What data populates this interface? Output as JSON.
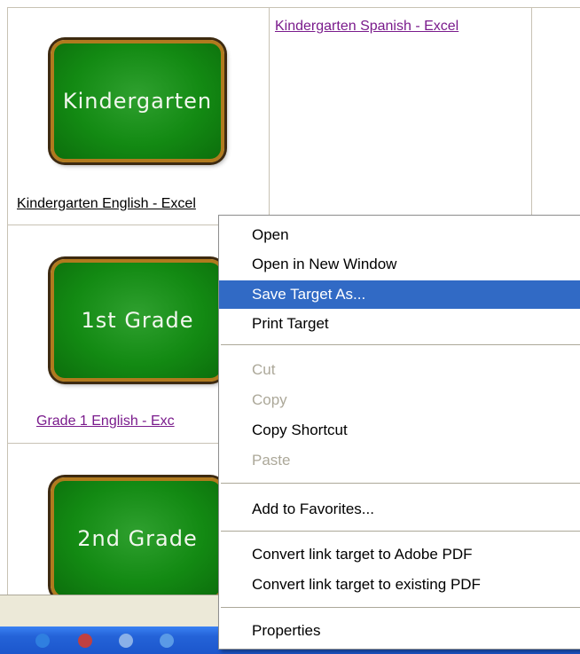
{
  "grid": {
    "k_board": "Kindergarten",
    "k_english_link": "Kindergarten English - Excel",
    "k_spanish_link": "Kindergarten Spanish - Excel",
    "g1_board": "1st Grade",
    "g1_english_link": "Grade 1 English - Exc",
    "g2_board": "2nd Grade"
  },
  "context_menu": {
    "open": "Open",
    "open_new_window": "Open in New Window",
    "save_target_as": "Save Target As...",
    "print_target": "Print Target",
    "cut": "Cut",
    "copy": "Copy",
    "copy_shortcut": "Copy Shortcut",
    "paste": "Paste",
    "add_to_favorites": "Add to Favorites...",
    "convert_adobe_pdf": "Convert link target to Adobe PDF",
    "convert_existing_pdf": "Convert link target to existing PDF",
    "properties": "Properties"
  },
  "colors": {
    "menu_highlight": "#316ac5",
    "visited_link": "#7a1b8c",
    "chalkboard": "#138a13"
  }
}
